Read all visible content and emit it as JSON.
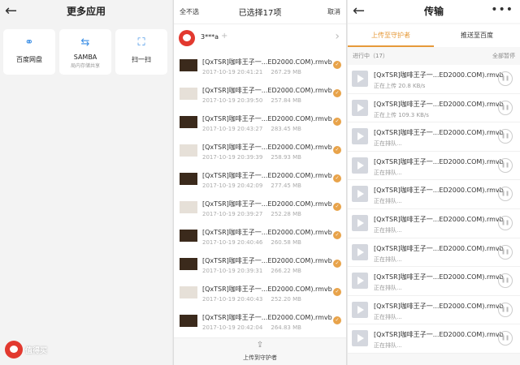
{
  "panel1": {
    "title": "更多应用",
    "apps": [
      {
        "label": "百度网盘",
        "sub": "",
        "icon": "cloud-icon",
        "glyph": "⚭"
      },
      {
        "label": "SAMBA",
        "sub": "局内存储共享",
        "icon": "swap-icon",
        "glyph": "⇆"
      },
      {
        "label": "扫一扫",
        "sub": "",
        "icon": "scan-icon",
        "glyph": "⛶"
      }
    ],
    "logo_text": "值得买"
  },
  "panel2": {
    "left_action": "全不选",
    "title": "已选择17项",
    "right_action": "取消",
    "account": {
      "name": "3***a",
      "plus": "+"
    },
    "files": [
      {
        "name": "[QxTSR]咖啡王子一...ED2000.COM).rmvb",
        "date": "2017-10-19 20:41:21",
        "size": "267.29 MB",
        "thumb": "dark"
      },
      {
        "name": "[QxTSR]咖啡王子一...ED2000.COM).rmvb",
        "date": "2017-10-19 20:39:50",
        "size": "257.84 MB",
        "thumb": "light"
      },
      {
        "name": "[QxTSR]咖啡王子一...ED2000.COM).rmvb",
        "date": "2017-10-19 20:43:27",
        "size": "283.45 MB",
        "thumb": "dark"
      },
      {
        "name": "[QxTSR]咖啡王子一...ED2000.COM).rmvb",
        "date": "2017-10-19 20:39:39",
        "size": "258.93 MB",
        "thumb": "light"
      },
      {
        "name": "[QxTSR]咖啡王子一...ED2000.COM).rmvb",
        "date": "2017-10-19 20:42:09",
        "size": "277.45 MB",
        "thumb": "dark"
      },
      {
        "name": "[QxTSR]咖啡王子一...ED2000.COM).rmvb",
        "date": "2017-10-19 20:39:27",
        "size": "252.28 MB",
        "thumb": "light"
      },
      {
        "name": "[QxTSR]咖啡王子一...ED2000.COM).rmvb",
        "date": "2017-10-19 20:40:46",
        "size": "260.58 MB",
        "thumb": "dark"
      },
      {
        "name": "[QxTSR]咖啡王子一...ED2000.COM).rmvb",
        "date": "2017-10-19 20:39:31",
        "size": "266.22 MB",
        "thumb": "dark"
      },
      {
        "name": "[QxTSR]咖啡王子一...ED2000.COM).rmvb",
        "date": "2017-10-19 20:40:43",
        "size": "252.20 MB",
        "thumb": "light"
      },
      {
        "name": "[QxTSR]咖啡王子一...ED2000.COM).rmvb",
        "date": "2017-10-19 20:42:04",
        "size": "264.83 MB",
        "thumb": "dark"
      }
    ],
    "footer_label": "上传到守护者"
  },
  "panel3": {
    "title": "传输",
    "more": "•••",
    "tabs": [
      "上传至守护者",
      "推送至百度"
    ],
    "section_label": "进行中（17）",
    "section_action": "全部暂停",
    "uploads": [
      {
        "name": "[QxTSR]咖啡王子一...ED2000.COM).rmvb",
        "status": "正在上传 20.8 KB/s"
      },
      {
        "name": "[QxTSR]咖啡王子一...ED2000.COM).rmvb",
        "status": "正在上传 109.3 KB/s"
      },
      {
        "name": "[QxTSR]咖啡王子一...ED2000.COM).rmvb",
        "status": "正在排队..."
      },
      {
        "name": "[QxTSR]咖啡王子一...ED2000.COM).rmvb",
        "status": "正在排队..."
      },
      {
        "name": "[QxTSR]咖啡王子一...ED2000.COM).rmvb",
        "status": "正在排队..."
      },
      {
        "name": "[QxTSR]咖啡王子一...ED2000.COM).rmvb",
        "status": "正在排队..."
      },
      {
        "name": "[QxTSR]咖啡王子一...ED2000.COM).rmvb",
        "status": "正在排队..."
      },
      {
        "name": "[QxTSR]咖啡王子一...ED2000.COM).rmvb",
        "status": "正在排队..."
      },
      {
        "name": "[QxTSR]咖啡王子一...ED2000.COM).rmvb",
        "status": "正在排队..."
      },
      {
        "name": "[QxTSR]咖啡王子一...ED2000.COM).rmvb",
        "status": "正在排队..."
      }
    ]
  },
  "colors": {
    "accent": "#e69a3a",
    "check": "#e8a34a",
    "brand_red": "#e2392f",
    "icon_blue": "#3a8ee6"
  }
}
